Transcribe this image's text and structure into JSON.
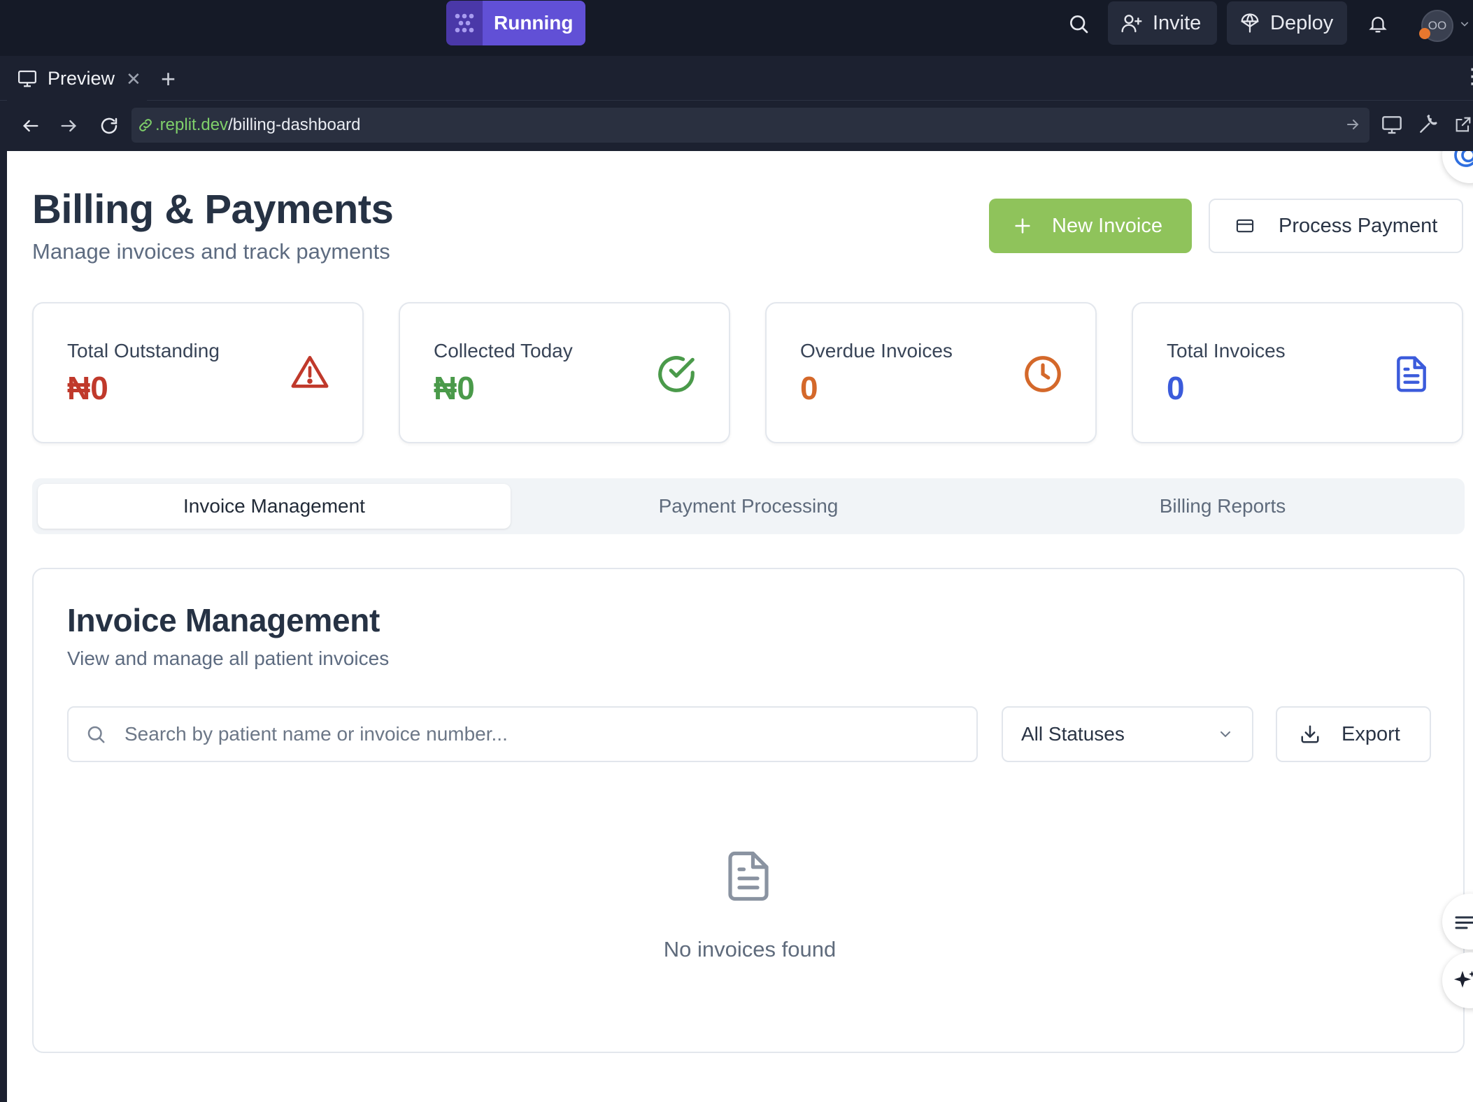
{
  "ide": {
    "run_label": "Running",
    "invite_label": "Invite",
    "deploy_label": "Deploy",
    "avatar_initials": "OO"
  },
  "preview": {
    "tab_label": "Preview",
    "url_domain": ".replit.dev",
    "url_path": "/billing-dashboard"
  },
  "header": {
    "title": "Billing & Payments",
    "subtitle": "Manage invoices and track payments",
    "new_invoice_label": "New Invoice",
    "process_payment_label": "Process Payment"
  },
  "stats": [
    {
      "label": "Total Outstanding",
      "value": "₦0",
      "color": "#c0392b",
      "icon": "alert-triangle-icon"
    },
    {
      "label": "Collected Today",
      "value": "₦0",
      "color": "#4a9a4a",
      "icon": "check-circle-icon"
    },
    {
      "label": "Overdue Invoices",
      "value": "0",
      "color": "#d4682a",
      "icon": "clock-icon"
    },
    {
      "label": "Total Invoices",
      "value": "0",
      "color": "#3b5bdb",
      "icon": "file-text-icon"
    }
  ],
  "tabs": [
    {
      "label": "Invoice Management",
      "active": true
    },
    {
      "label": "Payment Processing",
      "active": false
    },
    {
      "label": "Billing Reports",
      "active": false
    }
  ],
  "invoices": {
    "title": "Invoice Management",
    "subtitle": "View and manage all patient invoices",
    "search_placeholder": "Search by patient name or invoice number...",
    "status_filter": "All Statuses",
    "export_label": "Export",
    "empty_text": "No invoices found"
  },
  "colors": {
    "accent_green": "#8fc35b",
    "run_purple": "#6150d6"
  }
}
